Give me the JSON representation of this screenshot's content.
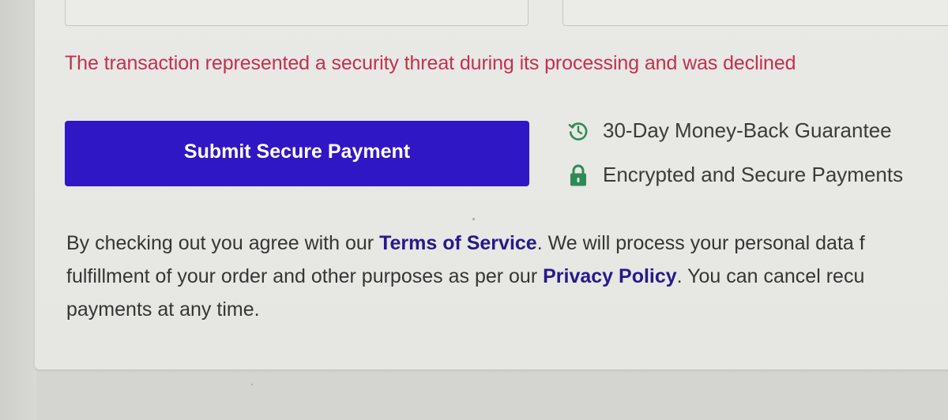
{
  "error": {
    "message": "The transaction represented a security threat during its processing and was declined"
  },
  "submit": {
    "label": "Submit Secure Payment"
  },
  "guarantees": [
    {
      "icon": "history-clock-icon",
      "label": "30-Day Money-Back Guarantee"
    },
    {
      "icon": "lock-icon",
      "label": "Encrypted and Secure Payments"
    }
  ],
  "legal": {
    "line1_prefix": "By checking out you agree with our ",
    "terms_link": "Terms of Service",
    "line1_suffix": ". We will process your personal data f",
    "line2_prefix": "fulfillment of your order and other purposes as per our ",
    "privacy_link": "Privacy Policy",
    "line2_suffix": ". You can cancel recu",
    "line3": "payments at any time."
  },
  "colors": {
    "error": "#c4314b",
    "button": "#2f17c6",
    "link": "#241a8a",
    "guarantee_icon": "#2e8b57"
  }
}
